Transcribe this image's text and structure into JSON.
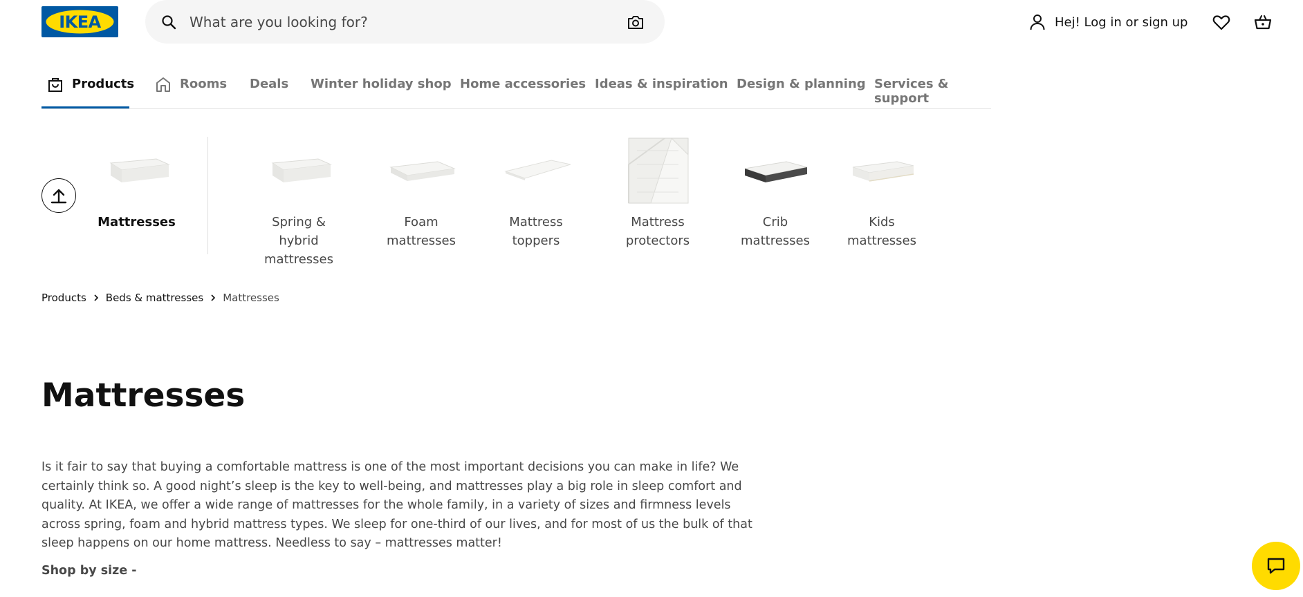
{
  "header": {
    "logo_text": "IKEA",
    "search_placeholder": "What are you looking for?",
    "login_label": "Hej! Log in or sign up"
  },
  "nav": {
    "items": [
      {
        "label": "Products",
        "icon": "shopping-bag-icon"
      },
      {
        "label": "Rooms",
        "icon": "home-icon"
      },
      {
        "label": "Deals"
      },
      {
        "label": "Winter holiday shop"
      },
      {
        "label": "Home accessories"
      },
      {
        "label": "Ideas & inspiration"
      },
      {
        "label": "Design & planning"
      },
      {
        "label": "Services & support"
      }
    ],
    "active_index": 0
  },
  "categories": {
    "current": {
      "label": "Mattresses"
    },
    "items": [
      {
        "label": "Spring & hybrid mattresses"
      },
      {
        "label": "Foam mattresses"
      },
      {
        "label": "Mattress toppers"
      },
      {
        "label": "Mattress protectors"
      },
      {
        "label": "Crib mattresses"
      },
      {
        "label": "Kids mattresses"
      }
    ]
  },
  "breadcrumb": [
    "Products",
    "Beds & mattresses",
    "Mattresses"
  ],
  "page_title": "Mattresses",
  "intro_text": "Is it fair to say that buying a comfortable mattress is one of the most important decisions you can make in life? We certainly think so. A good night’s sleep is the key to well-being, and mattresses play a big role in sleep comfort and quality. At IKEA, we offer a wide range of mattresses for the whole family, in a variety of sizes and firmness levels across spring, foam and hybrid mattress types. We sleep for one-third of our lives, and for most of us the bulk of that sleep happens on our home mattress. Needless to say – mattresses matter!",
  "shop_by_size_label": "Shop by size -",
  "colors": {
    "brand_blue": "#0058a3",
    "brand_yellow": "#ffdb00",
    "text_primary": "#111111",
    "text_secondary": "#484848",
    "text_muted": "#767676"
  }
}
